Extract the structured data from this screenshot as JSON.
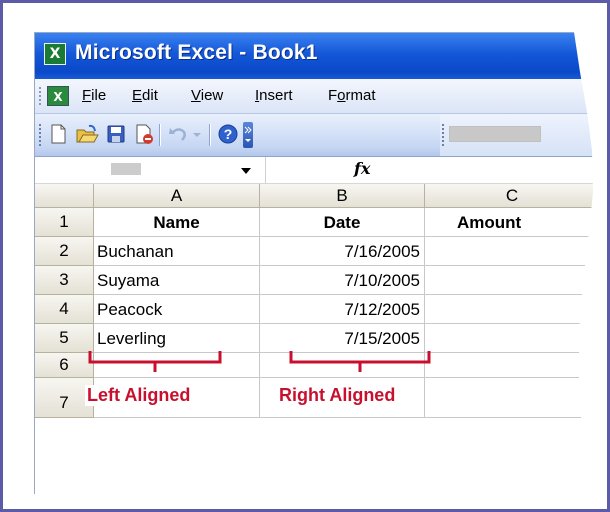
{
  "window": {
    "title": "Microsoft Excel - Book1"
  },
  "menu": {
    "items": [
      {
        "label": "File",
        "underline": "F",
        "rest": "ile"
      },
      {
        "label": "Edit",
        "underline": "E",
        "rest": "dit"
      },
      {
        "label": "View",
        "underline": "V",
        "rest": "iew"
      },
      {
        "label": "Insert",
        "underline": "I",
        "rest": "nsert"
      },
      {
        "label": "Format",
        "pre": "F",
        "underline": "o",
        "rest": "rmat"
      }
    ]
  },
  "toolbar": {
    "icons": [
      "new-icon",
      "open-icon",
      "save-icon",
      "permission-icon",
      "undo-icon",
      "undo-dropdown-icon",
      "help-icon",
      "toolbar-options-icon"
    ]
  },
  "formula_bar": {
    "fx_label": "fx"
  },
  "sheet": {
    "columns": [
      "A",
      "B",
      "C"
    ],
    "rows": [
      {
        "num": "1",
        "a": "Name",
        "b": "Date",
        "c": "Amount"
      },
      {
        "num": "2",
        "a": "Buchanan",
        "b": "7/16/2005",
        "c": ""
      },
      {
        "num": "3",
        "a": "Suyama",
        "b": "7/10/2005",
        "c": ""
      },
      {
        "num": "4",
        "a": "Peacock",
        "b": "7/12/2005",
        "c": ""
      },
      {
        "num": "5",
        "a": "Leverling",
        "b": "7/15/2005",
        "c": ""
      },
      {
        "num": "6",
        "a": "",
        "b": "",
        "c": ""
      },
      {
        "num": "7",
        "a": "",
        "b": "",
        "c": ""
      }
    ]
  },
  "annotations": {
    "left": "Left Aligned",
    "right": "Right Aligned",
    "color": "#c8102e"
  }
}
